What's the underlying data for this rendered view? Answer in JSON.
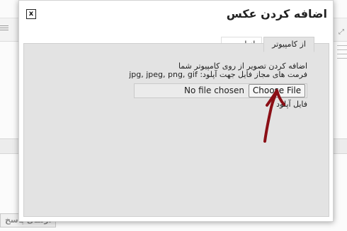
{
  "background": {
    "submit_label": "ارسال پاسخ"
  },
  "dialog": {
    "title": "اضافه کردن عکس",
    "close_label": "x",
    "tabs": [
      {
        "label": "از کامپیوتر",
        "active": true
      },
      {
        "label": "از ادرس",
        "active": false
      }
    ],
    "instructions": "اضافه کردن تصویر از روی کامپیوتر شما",
    "allowed_formats_label": "فرمت های مجاز فایل جهت آپلود:",
    "allowed_formats": "jpg, jpeg, png, gif",
    "file_input": {
      "button_label": "Choose File",
      "status": "No file chosen"
    },
    "upload_label": "فایل آپلود"
  },
  "colors": {
    "panel_bg": "#e3e3e3",
    "annotation_arrow": "#8b0f16"
  },
  "icons": {
    "close": "close-icon",
    "annotation": "hand-drawn-arrow-icon"
  }
}
